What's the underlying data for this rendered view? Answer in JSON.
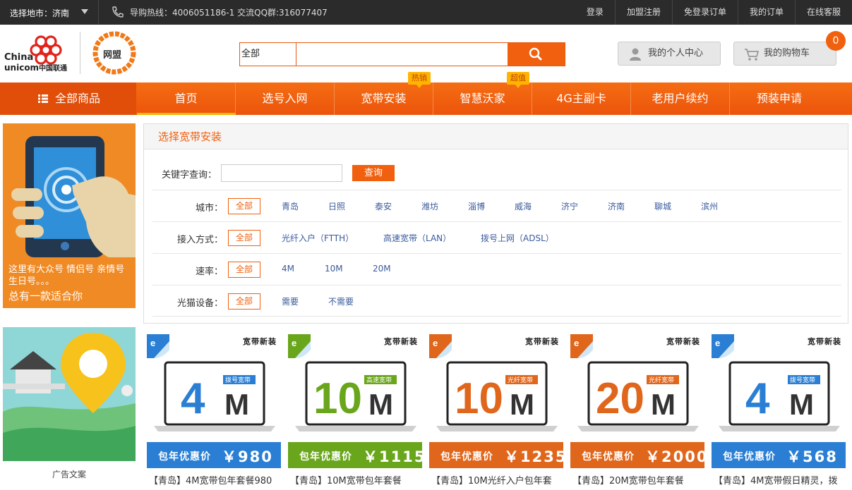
{
  "topbar": {
    "city_label": "选择地市：济南",
    "hotline": "导购热线：4006051186-1  交流QQ群:316077407",
    "links": [
      "登录",
      "加盟注册",
      "免登录订单",
      "我的订单",
      "在线客服"
    ]
  },
  "header": {
    "logo_text_en_1": "China",
    "logo_text_en_2": "unicom",
    "logo_text_cn": "中国联通",
    "wangmeng_text": "网盟",
    "search": {
      "category": "全部",
      "value": ""
    },
    "personal_center": "我的个人中心",
    "cart": "我的购物车",
    "cart_count": "0"
  },
  "nav": {
    "all_products": "全部商品",
    "items": [
      {
        "label": "首页",
        "badge": ""
      },
      {
        "label": "选号入网",
        "badge": ""
      },
      {
        "label": "宽带安装",
        "badge": "热销"
      },
      {
        "label": "智慧沃家",
        "badge": ""
      },
      {
        "label": "4G主副卡",
        "badge": "超值"
      },
      {
        "label": "老用户续约",
        "badge": ""
      },
      {
        "label": "预装申请",
        "badge": ""
      }
    ]
  },
  "ads": {
    "ad1_line1": "这里有大众号 情侣号 亲情号 生日号。。。",
    "ad1_line2": "总有一款适合你",
    "ad2_caption": "广告文案"
  },
  "filter": {
    "title": "选择宽带安装",
    "keyword_label": "关键字查询：",
    "keyword_value": "",
    "query_button": "查询",
    "rows": [
      {
        "label": "城市：",
        "selected": "全部",
        "options": [
          "青岛",
          "日照",
          "泰安",
          "潍坊",
          "淄博",
          "威海",
          "济宁",
          "济南",
          "聊城",
          "滨州"
        ]
      },
      {
        "label": "接入方式：",
        "selected": "全部",
        "options": [
          "光纤入户（FTTH）",
          "高速宽带（LAN）",
          "拨号上网（ADSL）"
        ]
      },
      {
        "label": "速率：",
        "selected": "全部",
        "options": [
          "4M",
          "10M",
          "20M"
        ]
      },
      {
        "label": "光猫设备：",
        "selected": "全部",
        "options": [
          "需要",
          "不需要"
        ]
      }
    ]
  },
  "products": [
    {
      "corner": "宽带新装",
      "speed": "4",
      "unit": "M",
      "type_tag": "拨号宽带",
      "price_label": "包年优惠价",
      "price": "￥980",
      "title": "【青岛】4M宽带包年套餐980",
      "color": "#2a7fd4"
    },
    {
      "corner": "宽带新装",
      "speed": "10",
      "unit": "M",
      "type_tag": "高速宽带",
      "price_label": "包年优惠价",
      "price": "￥1115",
      "title": "【青岛】10M宽带包年套餐",
      "color": "#6aa61c"
    },
    {
      "corner": "宽带新装",
      "speed": "10",
      "unit": "M",
      "type_tag": "光纤宽带",
      "price_label": "包年优惠价",
      "price": "￥1235",
      "title": "【青岛】10M光纤入户包年套",
      "color": "#e0661c"
    },
    {
      "corner": "宽带新装",
      "speed": "20",
      "unit": "M",
      "type_tag": "光纤宽带",
      "price_label": "包年优惠价",
      "price": "￥2000",
      "title": "【青岛】20M宽带包年套餐",
      "color": "#e0661c"
    },
    {
      "corner": "宽带新装",
      "speed": "4",
      "unit": "M",
      "type_tag": "拨号宽带",
      "price_label": "包年优惠价",
      "price": "￥568",
      "title": "【青岛】4M宽带假日精灵，拨",
      "color": "#2a7fd4"
    }
  ],
  "colors": {
    "accent": "#f0600e",
    "nav": "#f0600e",
    "dark": "#2b2b2b"
  }
}
